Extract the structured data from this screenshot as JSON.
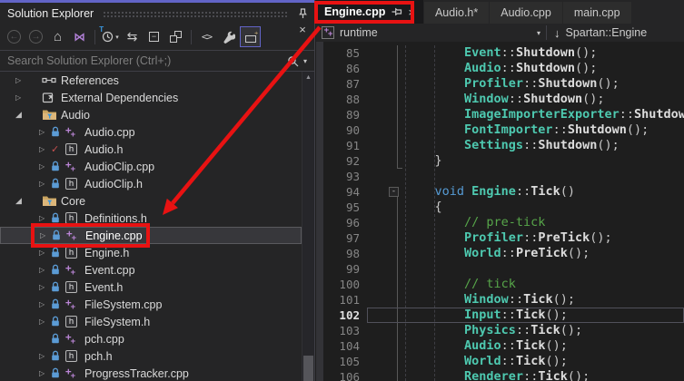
{
  "colors": {
    "annotation_red": "#E81212",
    "accent_purple": "#6264C7",
    "panel_bg": "#252526",
    "editor_bg": "#1E1E1E",
    "type_color": "#4EC9B0",
    "keyword_color": "#569CD6",
    "comment_color": "#57A64A"
  },
  "solution_explorer": {
    "title": "Solution Explorer",
    "titlebar_buttons": [
      {
        "name": "window-position",
        "icon": "chevron-down"
      },
      {
        "name": "pin",
        "icon": "pin"
      },
      {
        "name": "close",
        "icon": "close"
      }
    ],
    "toolbar": [
      {
        "name": "back",
        "icon": "arrow-left-circle",
        "disabled": true
      },
      {
        "name": "forward",
        "icon": "arrow-right-circle",
        "disabled": true
      },
      {
        "name": "home",
        "icon": "home"
      },
      {
        "name": "switch-views",
        "icon": "vs-switch"
      },
      {
        "sep": true
      },
      {
        "name": "pending-changes-filter",
        "icon": "clock-filter",
        "dropdown": true
      },
      {
        "name": "sync-with-active-document",
        "icon": "sync"
      },
      {
        "name": "collapse-all",
        "icon": "collapse-all"
      },
      {
        "name": "show-all-files",
        "icon": "show-all-files"
      },
      {
        "sep": true
      },
      {
        "name": "view-code",
        "icon": "code"
      },
      {
        "name": "properties",
        "icon": "wrench"
      },
      {
        "name": "preview-selected-items",
        "icon": "preview",
        "active": true
      }
    ],
    "search": {
      "placeholder": "Search Solution Explorer (Ctrl+;)"
    },
    "tree": [
      {
        "label": "References",
        "level": 1,
        "expander": "collapsed",
        "icon": "references"
      },
      {
        "label": "External Dependencies",
        "level": 1,
        "expander": "collapsed",
        "icon": "ext-deps"
      },
      {
        "label": "Audio",
        "level": 1,
        "expander": "expanded",
        "icon": "folder-filter"
      },
      {
        "label": "Audio.cpp",
        "level": 2,
        "expander": "collapsed",
        "status": "lock",
        "icon": "cpp"
      },
      {
        "label": "Audio.h",
        "level": 2,
        "expander": "collapsed",
        "status": "check",
        "icon": "h"
      },
      {
        "label": "AudioClip.cpp",
        "level": 2,
        "expander": "collapsed",
        "status": "lock",
        "icon": "cpp"
      },
      {
        "label": "AudioClip.h",
        "level": 2,
        "expander": "collapsed",
        "status": "lock",
        "icon": "h"
      },
      {
        "label": "Core",
        "level": 1,
        "expander": "expanded",
        "icon": "folder-filter"
      },
      {
        "label": "Definitions.h",
        "level": 2,
        "expander": "collapsed",
        "status": "lock",
        "icon": "h"
      },
      {
        "label": "Engine.cpp",
        "level": 2,
        "expander": "collapsed",
        "status": "lock",
        "icon": "cpp",
        "selected": true,
        "annotated": true
      },
      {
        "label": "Engine.h",
        "level": 2,
        "expander": "collapsed",
        "status": "lock",
        "icon": "h"
      },
      {
        "label": "Event.cpp",
        "level": 2,
        "expander": "collapsed",
        "status": "lock",
        "icon": "cpp"
      },
      {
        "label": "Event.h",
        "level": 2,
        "expander": "collapsed",
        "status": "lock",
        "icon": "h"
      },
      {
        "label": "FileSystem.cpp",
        "level": 2,
        "expander": "collapsed",
        "status": "lock",
        "icon": "cpp"
      },
      {
        "label": "FileSystem.h",
        "level": 2,
        "expander": "collapsed",
        "status": "lock",
        "icon": "h"
      },
      {
        "label": "pch.cpp",
        "level": 2,
        "expander": "none",
        "status": "lock",
        "icon": "cpp"
      },
      {
        "label": "pch.h",
        "level": 2,
        "expander": "collapsed",
        "status": "lock",
        "icon": "h"
      },
      {
        "label": "ProgressTracker.cpp",
        "level": 2,
        "expander": "collapsed",
        "status": "lock",
        "icon": "cpp"
      }
    ]
  },
  "editor": {
    "tabs": [
      {
        "label": "Engine.cpp",
        "active": true,
        "annotated": true
      },
      {
        "label": "Audio.h*"
      },
      {
        "label": "Audio.cpp"
      },
      {
        "label": "main.cpp"
      }
    ],
    "navbar": {
      "project": "runtime",
      "scope": "Spartan::Engine"
    },
    "code": {
      "first_line": 85,
      "current_line": 102,
      "lines": [
        {
          "n": 85,
          "ind": 2,
          "seg": [
            [
              "t",
              "Event"
            ],
            [
              "p",
              "::"
            ],
            [
              "f",
              "Shutdown"
            ],
            [
              "p",
              "();"
            ]
          ]
        },
        {
          "n": 86,
          "ind": 2,
          "seg": [
            [
              "t",
              "Audio"
            ],
            [
              "p",
              "::"
            ],
            [
              "f",
              "Shutdown"
            ],
            [
              "p",
              "();"
            ]
          ]
        },
        {
          "n": 87,
          "ind": 2,
          "seg": [
            [
              "t",
              "Profiler"
            ],
            [
              "p",
              "::"
            ],
            [
              "f",
              "Shutdown"
            ],
            [
              "p",
              "();"
            ]
          ]
        },
        {
          "n": 88,
          "ind": 2,
          "seg": [
            [
              "t",
              "Window"
            ],
            [
              "p",
              "::"
            ],
            [
              "f",
              "Shutdown"
            ],
            [
              "p",
              "();"
            ]
          ]
        },
        {
          "n": 89,
          "ind": 2,
          "seg": [
            [
              "t",
              "ImageImporterExporter"
            ],
            [
              "p",
              "::"
            ],
            [
              "f",
              "Shutdown"
            ],
            [
              "p",
              "();"
            ]
          ]
        },
        {
          "n": 90,
          "ind": 2,
          "seg": [
            [
              "t",
              "FontImporter"
            ],
            [
              "p",
              "::"
            ],
            [
              "f",
              "Shutdown"
            ],
            [
              "p",
              "();"
            ]
          ]
        },
        {
          "n": 91,
          "ind": 2,
          "seg": [
            [
              "t",
              "Settings"
            ],
            [
              "p",
              "::"
            ],
            [
              "f",
              "Shutdown"
            ],
            [
              "p",
              "();"
            ]
          ]
        },
        {
          "n": 92,
          "ind": 1,
          "seg": [
            [
              "p",
              "}"
            ]
          ]
        },
        {
          "n": 93,
          "ind": 0,
          "seg": []
        },
        {
          "n": 94,
          "ind": 1,
          "fold": true,
          "seg": [
            [
              "k",
              "void "
            ],
            [
              "t",
              "Engine"
            ],
            [
              "p",
              "::"
            ],
            [
              "f",
              "Tick"
            ],
            [
              "p",
              "()"
            ]
          ]
        },
        {
          "n": 95,
          "ind": 1,
          "seg": [
            [
              "p",
              "{"
            ]
          ]
        },
        {
          "n": 96,
          "ind": 2,
          "seg": [
            [
              "c",
              "// pre-tick"
            ]
          ]
        },
        {
          "n": 97,
          "ind": 2,
          "seg": [
            [
              "t",
              "Profiler"
            ],
            [
              "p",
              "::"
            ],
            [
              "f",
              "PreTick"
            ],
            [
              "p",
              "();"
            ]
          ]
        },
        {
          "n": 98,
          "ind": 2,
          "seg": [
            [
              "t",
              "World"
            ],
            [
              "p",
              "::"
            ],
            [
              "f",
              "PreTick"
            ],
            [
              "p",
              "();"
            ]
          ]
        },
        {
          "n": 99,
          "ind": 0,
          "seg": []
        },
        {
          "n": 100,
          "ind": 2,
          "seg": [
            [
              "c",
              "// tick"
            ]
          ]
        },
        {
          "n": 101,
          "ind": 2,
          "seg": [
            [
              "t",
              "Window"
            ],
            [
              "p",
              "::"
            ],
            [
              "f",
              "Tick"
            ],
            [
              "p",
              "();"
            ]
          ]
        },
        {
          "n": 102,
          "ind": 2,
          "seg": [
            [
              "t",
              "Input"
            ],
            [
              "p",
              "::"
            ],
            [
              "f",
              "Tick"
            ],
            [
              "p",
              "();"
            ]
          ]
        },
        {
          "n": 103,
          "ind": 2,
          "seg": [
            [
              "t",
              "Physics"
            ],
            [
              "p",
              "::"
            ],
            [
              "f",
              "Tick"
            ],
            [
              "p",
              "();"
            ]
          ]
        },
        {
          "n": 104,
          "ind": 2,
          "seg": [
            [
              "t",
              "Audio"
            ],
            [
              "p",
              "::"
            ],
            [
              "f",
              "Tick"
            ],
            [
              "p",
              "();"
            ]
          ]
        },
        {
          "n": 105,
          "ind": 2,
          "seg": [
            [
              "t",
              "World"
            ],
            [
              "p",
              "::"
            ],
            [
              "f",
              "Tick"
            ],
            [
              "p",
              "();"
            ]
          ]
        },
        {
          "n": 106,
          "ind": 2,
          "seg": [
            [
              "t",
              "Renderer"
            ],
            [
              "p",
              "::"
            ],
            [
              "f",
              "Tick"
            ],
            [
              "p",
              "();"
            ]
          ]
        }
      ]
    }
  },
  "annotation": {
    "style": "red-callout",
    "highlighted_tab": "Engine.cpp",
    "highlighted_tree_item": "Engine.cpp",
    "arrow": "from-tab-to-tree-item"
  }
}
